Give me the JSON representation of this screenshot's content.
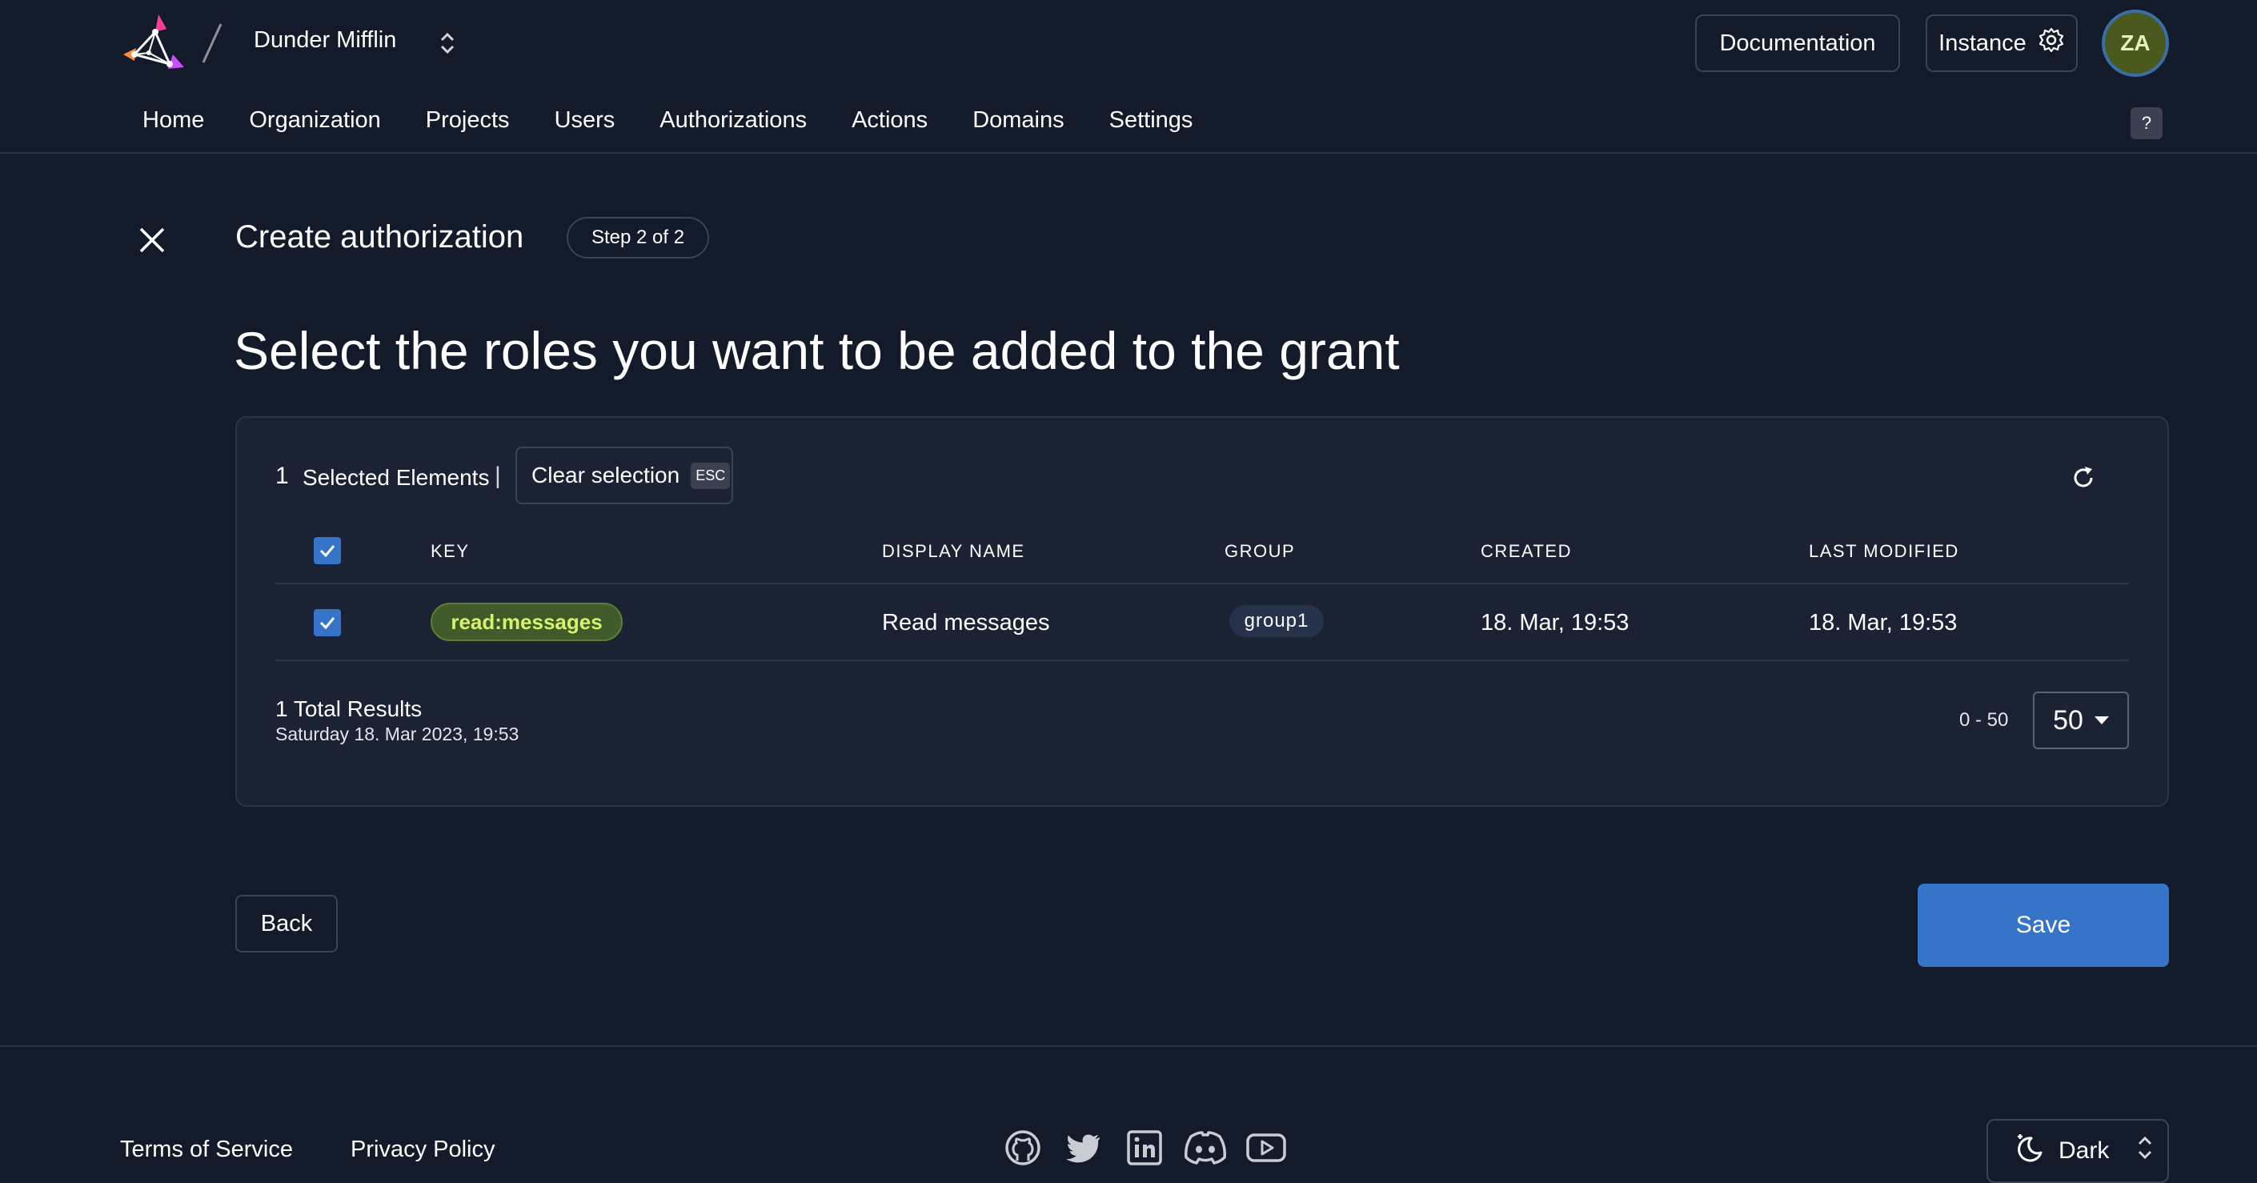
{
  "header": {
    "org_name": "Dunder Mifflin",
    "documentation_label": "Documentation",
    "instance_label": "Instance",
    "avatar_initials": "ZA",
    "help_label": "?"
  },
  "nav": {
    "items": [
      {
        "label": "Home"
      },
      {
        "label": "Organization"
      },
      {
        "label": "Projects"
      },
      {
        "label": "Users"
      },
      {
        "label": "Authorizations"
      },
      {
        "label": "Actions"
      },
      {
        "label": "Domains"
      },
      {
        "label": "Settings"
      }
    ]
  },
  "page": {
    "title": "Create authorization",
    "step": "Step 2 of 2",
    "heading": "Select the roles you want to be added to the grant"
  },
  "selection": {
    "count": "1",
    "label": "Selected Elements",
    "separator": "|",
    "clear_label": "Clear selection",
    "esc_label": "ESC"
  },
  "table": {
    "columns": [
      "KEY",
      "DISPLAY NAME",
      "GROUP",
      "CREATED",
      "LAST MODIFIED"
    ],
    "rows": [
      {
        "key": "read:messages",
        "display_name": "Read messages",
        "group": "group1",
        "created": "18. Mar, 19:53",
        "last_modified": "18. Mar, 19:53",
        "selected": true
      }
    ],
    "all_selected": true
  },
  "pagination": {
    "total": "1 Total Results",
    "timestamp": "Saturday 18. Mar 2023, 19:53",
    "range": "0 - 50",
    "page_size": "50"
  },
  "actions": {
    "back_label": "Back",
    "save_label": "Save"
  },
  "footer": {
    "terms_label": "Terms of Service",
    "privacy_label": "Privacy Policy",
    "social_icons": [
      "github-icon",
      "twitter-icon",
      "linkedin-icon",
      "discord-icon",
      "youtube-icon"
    ],
    "theme_label": "Dark"
  },
  "colors": {
    "background": "#131a29",
    "card": "#1b2234",
    "accent": "#3574c9",
    "key_chip_text": "#d6f36b",
    "avatar_bg": "#4a5a1f"
  }
}
